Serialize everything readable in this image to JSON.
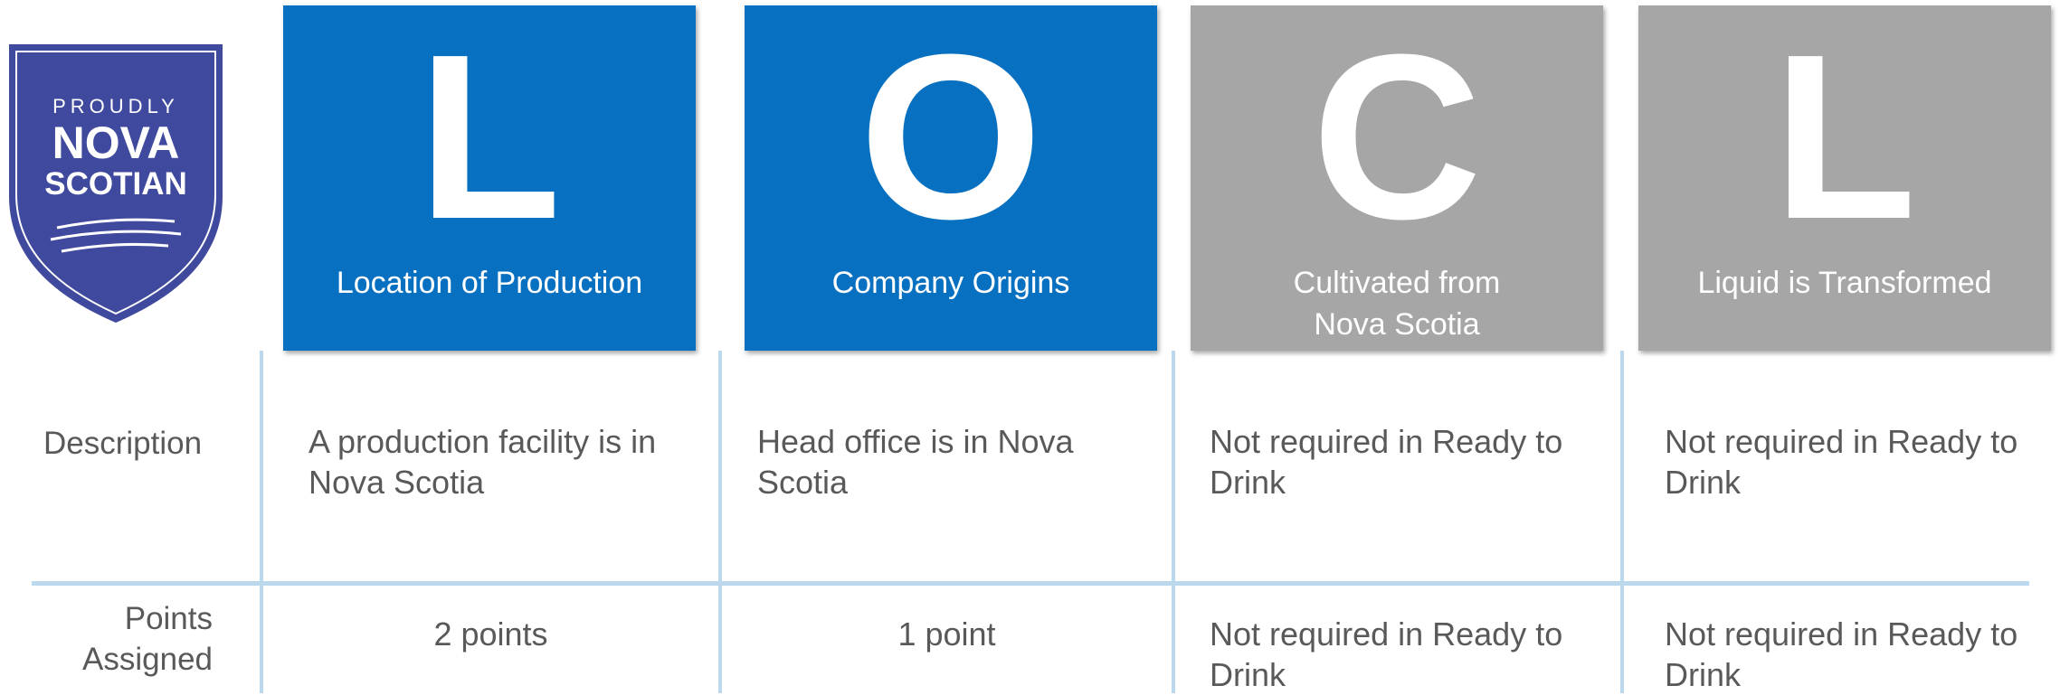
{
  "logo": {
    "line1": "PROUDLY",
    "line2": "NOVA",
    "line3": "SCOTIAN",
    "fill_color": "#3f4a9e"
  },
  "columns": [
    {
      "letter": "L",
      "title": "Location of Production",
      "color": "#0870c1"
    },
    {
      "letter": "O",
      "title": "Company Origins",
      "color": "#0870c1"
    },
    {
      "letter": "C",
      "title_line1": "Cultivated from",
      "title_line2": "Nova Scotia",
      "color": "#a6a6a6"
    },
    {
      "letter": "L",
      "title": "Liquid is Transformed",
      "color": "#a6a6a6"
    }
  ],
  "rows": {
    "description": {
      "label": "Description",
      "cells": [
        {
          "line1": "A production facility is in",
          "line2": "Nova Scotia"
        },
        {
          "line1": "Head office is in Nova",
          "line2": "Scotia"
        },
        {
          "line1": "Not required in Ready to",
          "line2": "Drink"
        },
        {
          "line1": "Not required in Ready to",
          "line2": "Drink"
        }
      ]
    },
    "points": {
      "label_line1": "Points",
      "label_line2": "Assigned",
      "cells": [
        {
          "line1": "2 points"
        },
        {
          "line1": "1 point"
        },
        {
          "line1": "Not required in Ready to",
          "line2": "Drink"
        },
        {
          "line1": "Not required in Ready to",
          "line2": "Drink"
        }
      ]
    }
  },
  "line_color": "#bcd8ec"
}
